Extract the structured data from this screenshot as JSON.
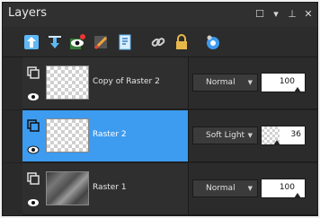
{
  "panel": {
    "title": "Layers",
    "accent": "#3d9bf0"
  },
  "window_buttons": [
    {
      "name": "maximize",
      "glyph": "☐"
    },
    {
      "name": "dropdown",
      "glyph": "▾"
    },
    {
      "name": "pin",
      "glyph": "⊥"
    },
    {
      "name": "close",
      "glyph": "✕"
    }
  ],
  "toolbar": {
    "buttons": [
      "move-up-icon",
      "move-down-icon",
      "view-toggle-icon",
      "edit-brush-icon",
      "properties-icon",
      "link-icon",
      "lock-icon",
      "mask-icon"
    ]
  },
  "layers": [
    {
      "name": "Copy of Raster 2",
      "blend_mode": "Normal",
      "opacity": "100",
      "selected": false
    },
    {
      "name": "Raster 2",
      "blend_mode": "Soft Light",
      "opacity": "36",
      "selected": true
    },
    {
      "name": "Raster 1",
      "blend_mode": "Normal",
      "opacity": "100",
      "selected": false
    }
  ]
}
